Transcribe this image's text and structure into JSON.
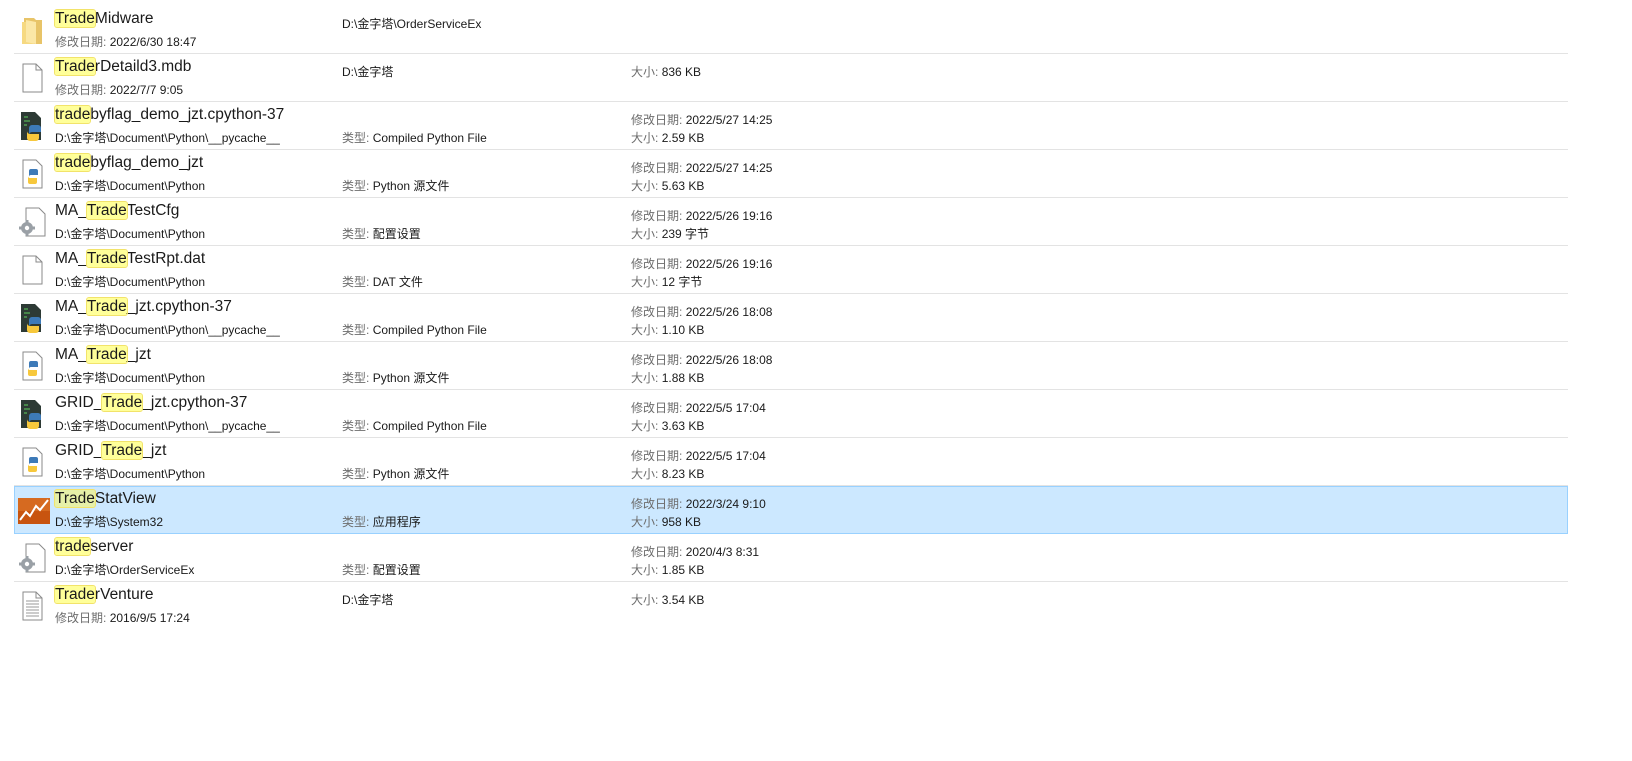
{
  "search_term": "Trade",
  "items": [
    {
      "icon": "folder",
      "pre": "",
      "hl": "Trade",
      "post": "Midware",
      "sub": {
        "label": "修改日期:",
        "value": "2022/6/30 18:47"
      },
      "mid_top": {
        "label": "",
        "value": "D:\\金字塔\\OrderServiceEx"
      },
      "mid_bot": null,
      "right_top": null,
      "right_bot": null
    },
    {
      "icon": "blank-file",
      "pre": "",
      "hl": "Trade",
      "post": "rDetaild3.mdb",
      "sub": {
        "label": "修改日期:",
        "value": "2022/7/7 9:05"
      },
      "mid_top": {
        "label": "",
        "value": "D:\\金字塔"
      },
      "mid_bot": null,
      "right_top": {
        "label": "大小:",
        "value": "836 KB"
      },
      "right_bot": null
    },
    {
      "icon": "pyc",
      "pre": "",
      "hl": "trade",
      "post": "byflag_demo_jzt.cpython-37",
      "sub": {
        "label": "",
        "value": "D:\\金字塔\\Document\\Python\\__pycache__"
      },
      "mid_top": null,
      "mid_bot": {
        "label": "类型:",
        "value": "Compiled Python File"
      },
      "right_top": {
        "label": "修改日期:",
        "value": "2022/5/27 14:25"
      },
      "right_bot": {
        "label": "大小:",
        "value": "2.59 KB"
      }
    },
    {
      "icon": "py",
      "pre": "",
      "hl": "trade",
      "post": "byflag_demo_jzt",
      "sub": {
        "label": "",
        "value": "D:\\金字塔\\Document\\Python"
      },
      "mid_top": null,
      "mid_bot": {
        "label": "类型:",
        "value": "Python 源文件"
      },
      "right_top": {
        "label": "修改日期:",
        "value": "2022/5/27 14:25"
      },
      "right_bot": {
        "label": "大小:",
        "value": "5.63 KB"
      }
    },
    {
      "icon": "config",
      "pre": "MA_",
      "hl": "Trade",
      "post": "TestCfg",
      "sub": {
        "label": "",
        "value": "D:\\金字塔\\Document\\Python"
      },
      "mid_top": null,
      "mid_bot": {
        "label": "类型:",
        "value": "配置设置"
      },
      "right_top": {
        "label": "修改日期:",
        "value": "2022/5/26 19:16"
      },
      "right_bot": {
        "label": "大小:",
        "value": "239 字节"
      }
    },
    {
      "icon": "blank-file",
      "pre": "MA_",
      "hl": "Trade",
      "post": "TestRpt.dat",
      "sub": {
        "label": "",
        "value": "D:\\金字塔\\Document\\Python"
      },
      "mid_top": null,
      "mid_bot": {
        "label": "类型:",
        "value": "DAT 文件"
      },
      "right_top": {
        "label": "修改日期:",
        "value": "2022/5/26 19:16"
      },
      "right_bot": {
        "label": "大小:",
        "value": "12 字节"
      }
    },
    {
      "icon": "pyc",
      "pre": "MA_",
      "hl": "Trade",
      "post": "_jzt.cpython-37",
      "sub": {
        "label": "",
        "value": "D:\\金字塔\\Document\\Python\\__pycache__"
      },
      "mid_top": null,
      "mid_bot": {
        "label": "类型:",
        "value": "Compiled Python File"
      },
      "right_top": {
        "label": "修改日期:",
        "value": "2022/5/26 18:08"
      },
      "right_bot": {
        "label": "大小:",
        "value": "1.10 KB"
      }
    },
    {
      "icon": "py",
      "pre": "MA_",
      "hl": "Trade",
      "post": "_jzt",
      "sub": {
        "label": "",
        "value": "D:\\金字塔\\Document\\Python"
      },
      "mid_top": null,
      "mid_bot": {
        "label": "类型:",
        "value": "Python 源文件"
      },
      "right_top": {
        "label": "修改日期:",
        "value": "2022/5/26 18:08"
      },
      "right_bot": {
        "label": "大小:",
        "value": "1.88 KB"
      }
    },
    {
      "icon": "pyc",
      "pre": "GRID_",
      "hl": "Trade",
      "post": "_jzt.cpython-37",
      "sub": {
        "label": "",
        "value": "D:\\金字塔\\Document\\Python\\__pycache__"
      },
      "mid_top": null,
      "mid_bot": {
        "label": "类型:",
        "value": "Compiled Python File"
      },
      "right_top": {
        "label": "修改日期:",
        "value": "2022/5/5 17:04"
      },
      "right_bot": {
        "label": "大小:",
        "value": "3.63 KB"
      }
    },
    {
      "icon": "py",
      "pre": "GRID_",
      "hl": "Trade",
      "post": "_jzt",
      "sub": {
        "label": "",
        "value": "D:\\金字塔\\Document\\Python"
      },
      "mid_top": null,
      "mid_bot": {
        "label": "类型:",
        "value": "Python 源文件"
      },
      "right_top": {
        "label": "修改日期:",
        "value": "2022/5/5 17:04"
      },
      "right_bot": {
        "label": "大小:",
        "value": "8.23 KB"
      }
    },
    {
      "icon": "app",
      "selected": true,
      "pre": "",
      "hl": "Trade",
      "post": "StatView",
      "sub": {
        "label": "",
        "value": "D:\\金字塔\\System32"
      },
      "mid_top": null,
      "mid_bot": {
        "label": "类型:",
        "value": "应用程序"
      },
      "right_top": {
        "label": "修改日期:",
        "value": "2022/3/24 9:10"
      },
      "right_bot": {
        "label": "大小:",
        "value": "958 KB"
      }
    },
    {
      "icon": "config",
      "pre": "",
      "hl": "trade",
      "post": "server",
      "sub": {
        "label": "",
        "value": "D:\\金字塔\\OrderServiceEx"
      },
      "mid_top": null,
      "mid_bot": {
        "label": "类型:",
        "value": "配置设置"
      },
      "right_top": {
        "label": "修改日期:",
        "value": "2020/4/3 8:31"
      },
      "right_bot": {
        "label": "大小:",
        "value": "1.85 KB"
      }
    },
    {
      "icon": "text-file",
      "pre": "",
      "hl": "Trade",
      "post": "rVenture",
      "sub": {
        "label": "修改日期:",
        "value": "2016/9/5 17:24"
      },
      "mid_top": {
        "label": "",
        "value": "D:\\金字塔"
      },
      "mid_bot": null,
      "right_top": {
        "label": "大小:",
        "value": "3.54 KB"
      },
      "right_bot": null
    }
  ],
  "colors": {
    "highlight": "#ffff99",
    "selection": "#cce8ff",
    "selection_border": "#99d1ff"
  }
}
